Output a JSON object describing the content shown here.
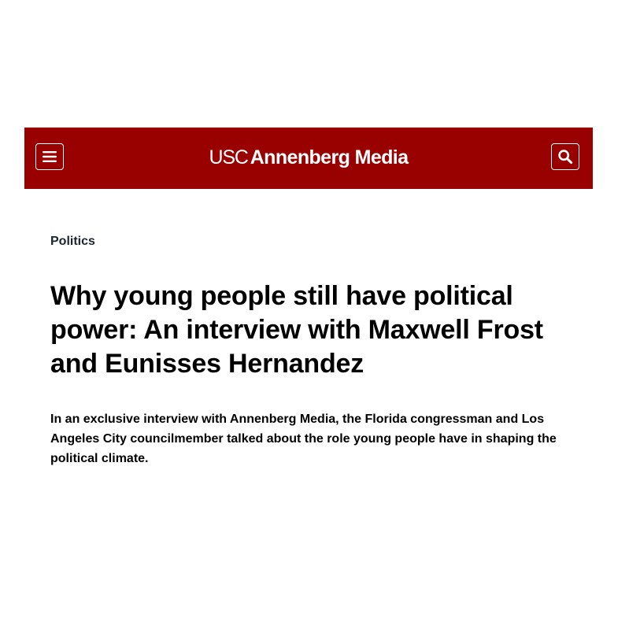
{
  "header": {
    "logo": {
      "prefix": "USC",
      "name": "Annenberg Media"
    },
    "menu_icon": "hamburger-menu-icon",
    "search_icon": "search-icon",
    "background_color": "#990000",
    "foreground_color": "#ffffff"
  },
  "article": {
    "category": "Politics",
    "headline": "Why young people still have political power: An interview with Maxwell Frost and Eunisses Hernandez",
    "dek": "In an exclusive interview with Annenberg Media, the Florida congressman and Los Angeles City councilmember talked about the role young people have in shaping the political climate."
  }
}
